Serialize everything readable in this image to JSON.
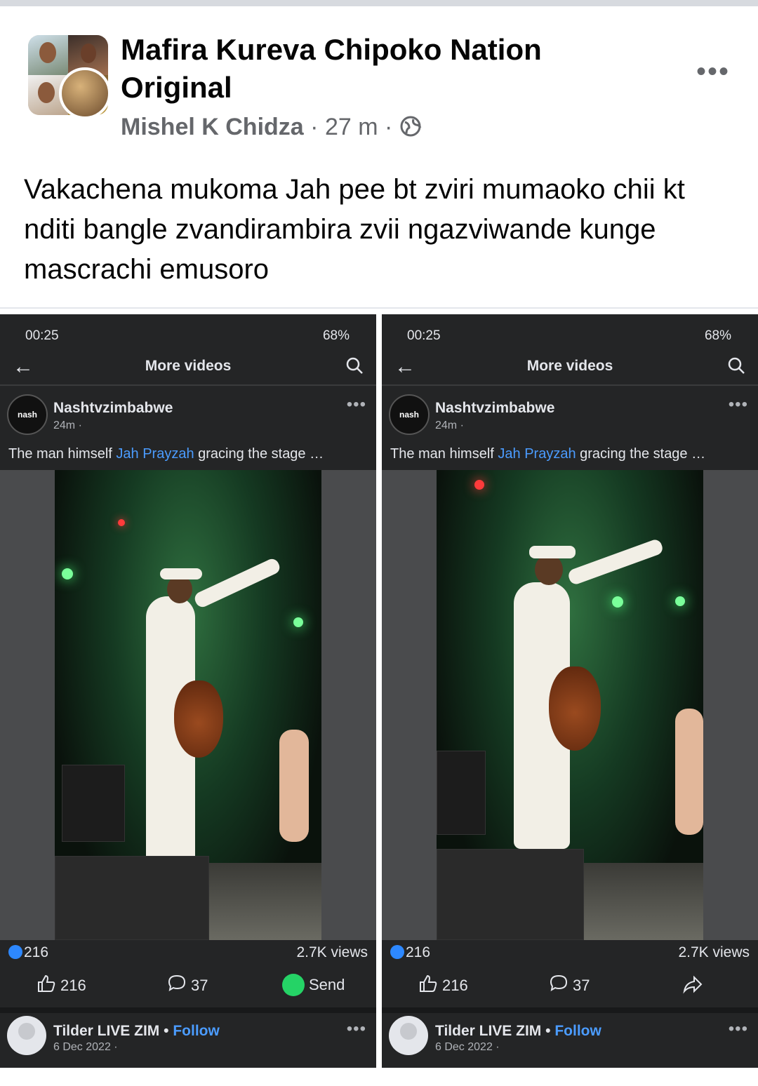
{
  "header": {
    "group_name": "Mafira Kureva Chipoko Nation Original",
    "author": "Mishel K Chidza",
    "separator": "·",
    "time": "27 m"
  },
  "post": {
    "text": "Vakachena mukoma Jah pee bt zviri mumaoko chii kt nditi bangle zvandirambira zvii ngazviwande kunge mascrachi emusoro"
  },
  "screenshots": [
    {
      "status_time": "00:25",
      "status_right": "68%",
      "nav_title": "More videos",
      "page_name": "Nashtvzimbabwe",
      "page_avatar_text": "nash",
      "page_meta": "24m ·",
      "caption_prefix": "The man himself ",
      "caption_link": "Jah Prayzah",
      "caption_suffix": " gracing the stage …",
      "reaction_count": "216",
      "views": "2.7K views",
      "like_label": "216",
      "comment_label": "37",
      "share_label": "Send",
      "next_name": "Tilder LIVE ZIM",
      "next_follow": "Follow",
      "next_meta": "6 Dec 2022 ·"
    },
    {
      "status_time": "00:25",
      "status_right": "68%",
      "nav_title": "More videos",
      "page_name": "Nashtvzimbabwe",
      "page_avatar_text": "nash",
      "page_meta": "24m ·",
      "caption_prefix": "The man himself ",
      "caption_link": "Jah Prayzah",
      "caption_suffix": " gracing the stage …",
      "reaction_count": "216",
      "views": "2.7K views",
      "like_label": "216",
      "comment_label": "37",
      "share_label": "",
      "next_name": "Tilder LIVE ZIM",
      "next_follow": "Follow",
      "next_meta": "6 Dec 2022 ·"
    }
  ],
  "colors": {
    "link_blue": "#4b9cff",
    "like_blue": "#2d88ff",
    "whatsapp_green": "#25d366",
    "dark_surface": "#242526"
  },
  "icons": [
    "globe-icon",
    "more-icon",
    "back-arrow-icon",
    "search-icon",
    "like-icon",
    "comment-icon",
    "whatsapp-icon",
    "share-arrow-icon"
  ]
}
